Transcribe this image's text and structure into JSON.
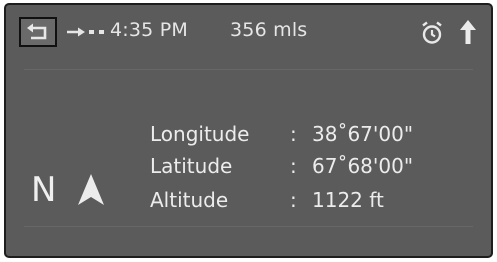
{
  "header": {
    "time": "4:35 PM",
    "distance": "356 mls"
  },
  "compass": {
    "heading": "N"
  },
  "coordinates": [
    {
      "label": "Longitude",
      "separator": ":",
      "value": "38˚67'00\""
    },
    {
      "label": "Latitude",
      "separator": ":",
      "value": "67˚68'00\""
    },
    {
      "label": "Altitude",
      "separator": ":",
      "value": "1122 ft"
    }
  ],
  "icons": {
    "back": "back-arrow-icon",
    "route": "route-arrow-icon",
    "alarm": "alarm-clock-icon",
    "direction": "up-arrow-icon",
    "navigation": "navigation-arrow-icon"
  },
  "colors": {
    "screen_background": "#5b5b5b",
    "text": "#eaeaea",
    "frame": "#1e1e1e"
  }
}
